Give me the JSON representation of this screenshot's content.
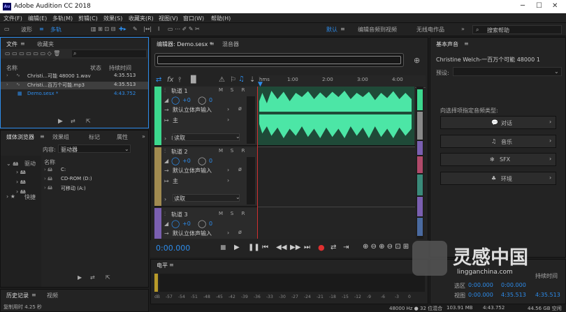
{
  "title": {
    "app": "Adobe Audition CC 2018",
    "icon": "Au"
  },
  "menu": [
    "文件(F)",
    "编辑(E)",
    "多轨(M)",
    "剪辑(C)",
    "效果(S)",
    "收藏夹(R)",
    "视图(V)",
    "窗口(W)",
    "帮助(H)"
  ],
  "toolbar": {
    "waveform": "波形",
    "multitrack": "多轨",
    "workspace_default": "默认",
    "workspace_edit_video": "编辑音频到视频",
    "workspace_radio": "无线电作品",
    "search": "搜索帮助"
  },
  "files": {
    "tab": "文件",
    "tab2": "收藏夹",
    "col_name": "名称",
    "col_status": "状态",
    "col_duration": "持续时间",
    "items": [
      {
        "name": "Christi...可能 48000 1.wav",
        "dur": "4:35.513"
      },
      {
        "name": "Christi...百万个可能.mp3",
        "dur": "4:35.513"
      },
      {
        "name": "Demo.sesx *",
        "dur": "4:43.752"
      }
    ]
  },
  "media": {
    "tabs": [
      "媒体浏览器",
      "效果组",
      "标记",
      "属性"
    ],
    "content_label": "内容:",
    "content_value": "驱动器",
    "col_name": "名称",
    "tree": [
      "驱动",
      "快捷"
    ],
    "items": [
      "C:",
      "CD-ROM (D:)",
      "可移动 (A:)"
    ]
  },
  "history": {
    "tab": "历史记录",
    "tab2": "视频",
    "status": "复制用时 4.25 秒"
  },
  "editor": {
    "tab": "编辑器: Demo.sesx *",
    "tab2": "混音器",
    "ruler": [
      "hms",
      "1:00",
      "2:00",
      "3:00",
      "4:00"
    ],
    "timecode": "0:00.000",
    "tracks": [
      {
        "name": "轨道 1",
        "vol": "+0",
        "input": "默认立体声输入",
        "output": "主",
        "mode": "读取"
      },
      {
        "name": "轨道 2",
        "vol": "+0",
        "input": "默认立体声输入",
        "output": "主",
        "mode": "读取"
      },
      {
        "name": "轨道 3",
        "vol": "+0",
        "input": "默认立体声输入"
      }
    ],
    "msr": [
      "M",
      "S",
      "R"
    ]
  },
  "level": {
    "tab": "电平",
    "ticks": [
      "dB",
      "-57",
      "-54",
      "-51",
      "-48",
      "-45",
      "-42",
      "-39",
      "-36",
      "-33",
      "-30",
      "-27",
      "-24",
      "-21",
      "-18",
      "-15",
      "-12",
      "-9",
      "-6",
      "-3",
      "0"
    ]
  },
  "essential": {
    "tab": "基本声音",
    "file": "Christine Welch-一百万个可能 48000 1",
    "preset": "预设:",
    "prompt": "向选择项指定音频类型:",
    "types": [
      "对话",
      "音乐",
      "SFX",
      "环境"
    ]
  },
  "selection": {
    "end_col": "持续时间",
    "sel": "选区",
    "view": "视图",
    "sel_start": "0:00.000",
    "sel_end": "0:00.000",
    "view_start": "0:00.000",
    "view_end": "4:35.513",
    "view_dur": "4:35.513"
  },
  "statusbar": {
    "rate": "48000 Hz ● 32 位混合",
    "size": "103.91 MB",
    "dur": "4:43.752",
    "free": "44.56 GB 空闲"
  },
  "watermark": {
    "text": "灵感中国",
    "url": "lingganchina.com"
  },
  "colors": {
    "accent": "#2d8ceb",
    "wave": "#4ce6a6",
    "track1": "#3cd88e",
    "track2": "#a08a50",
    "track3": "#7a5fb0"
  }
}
